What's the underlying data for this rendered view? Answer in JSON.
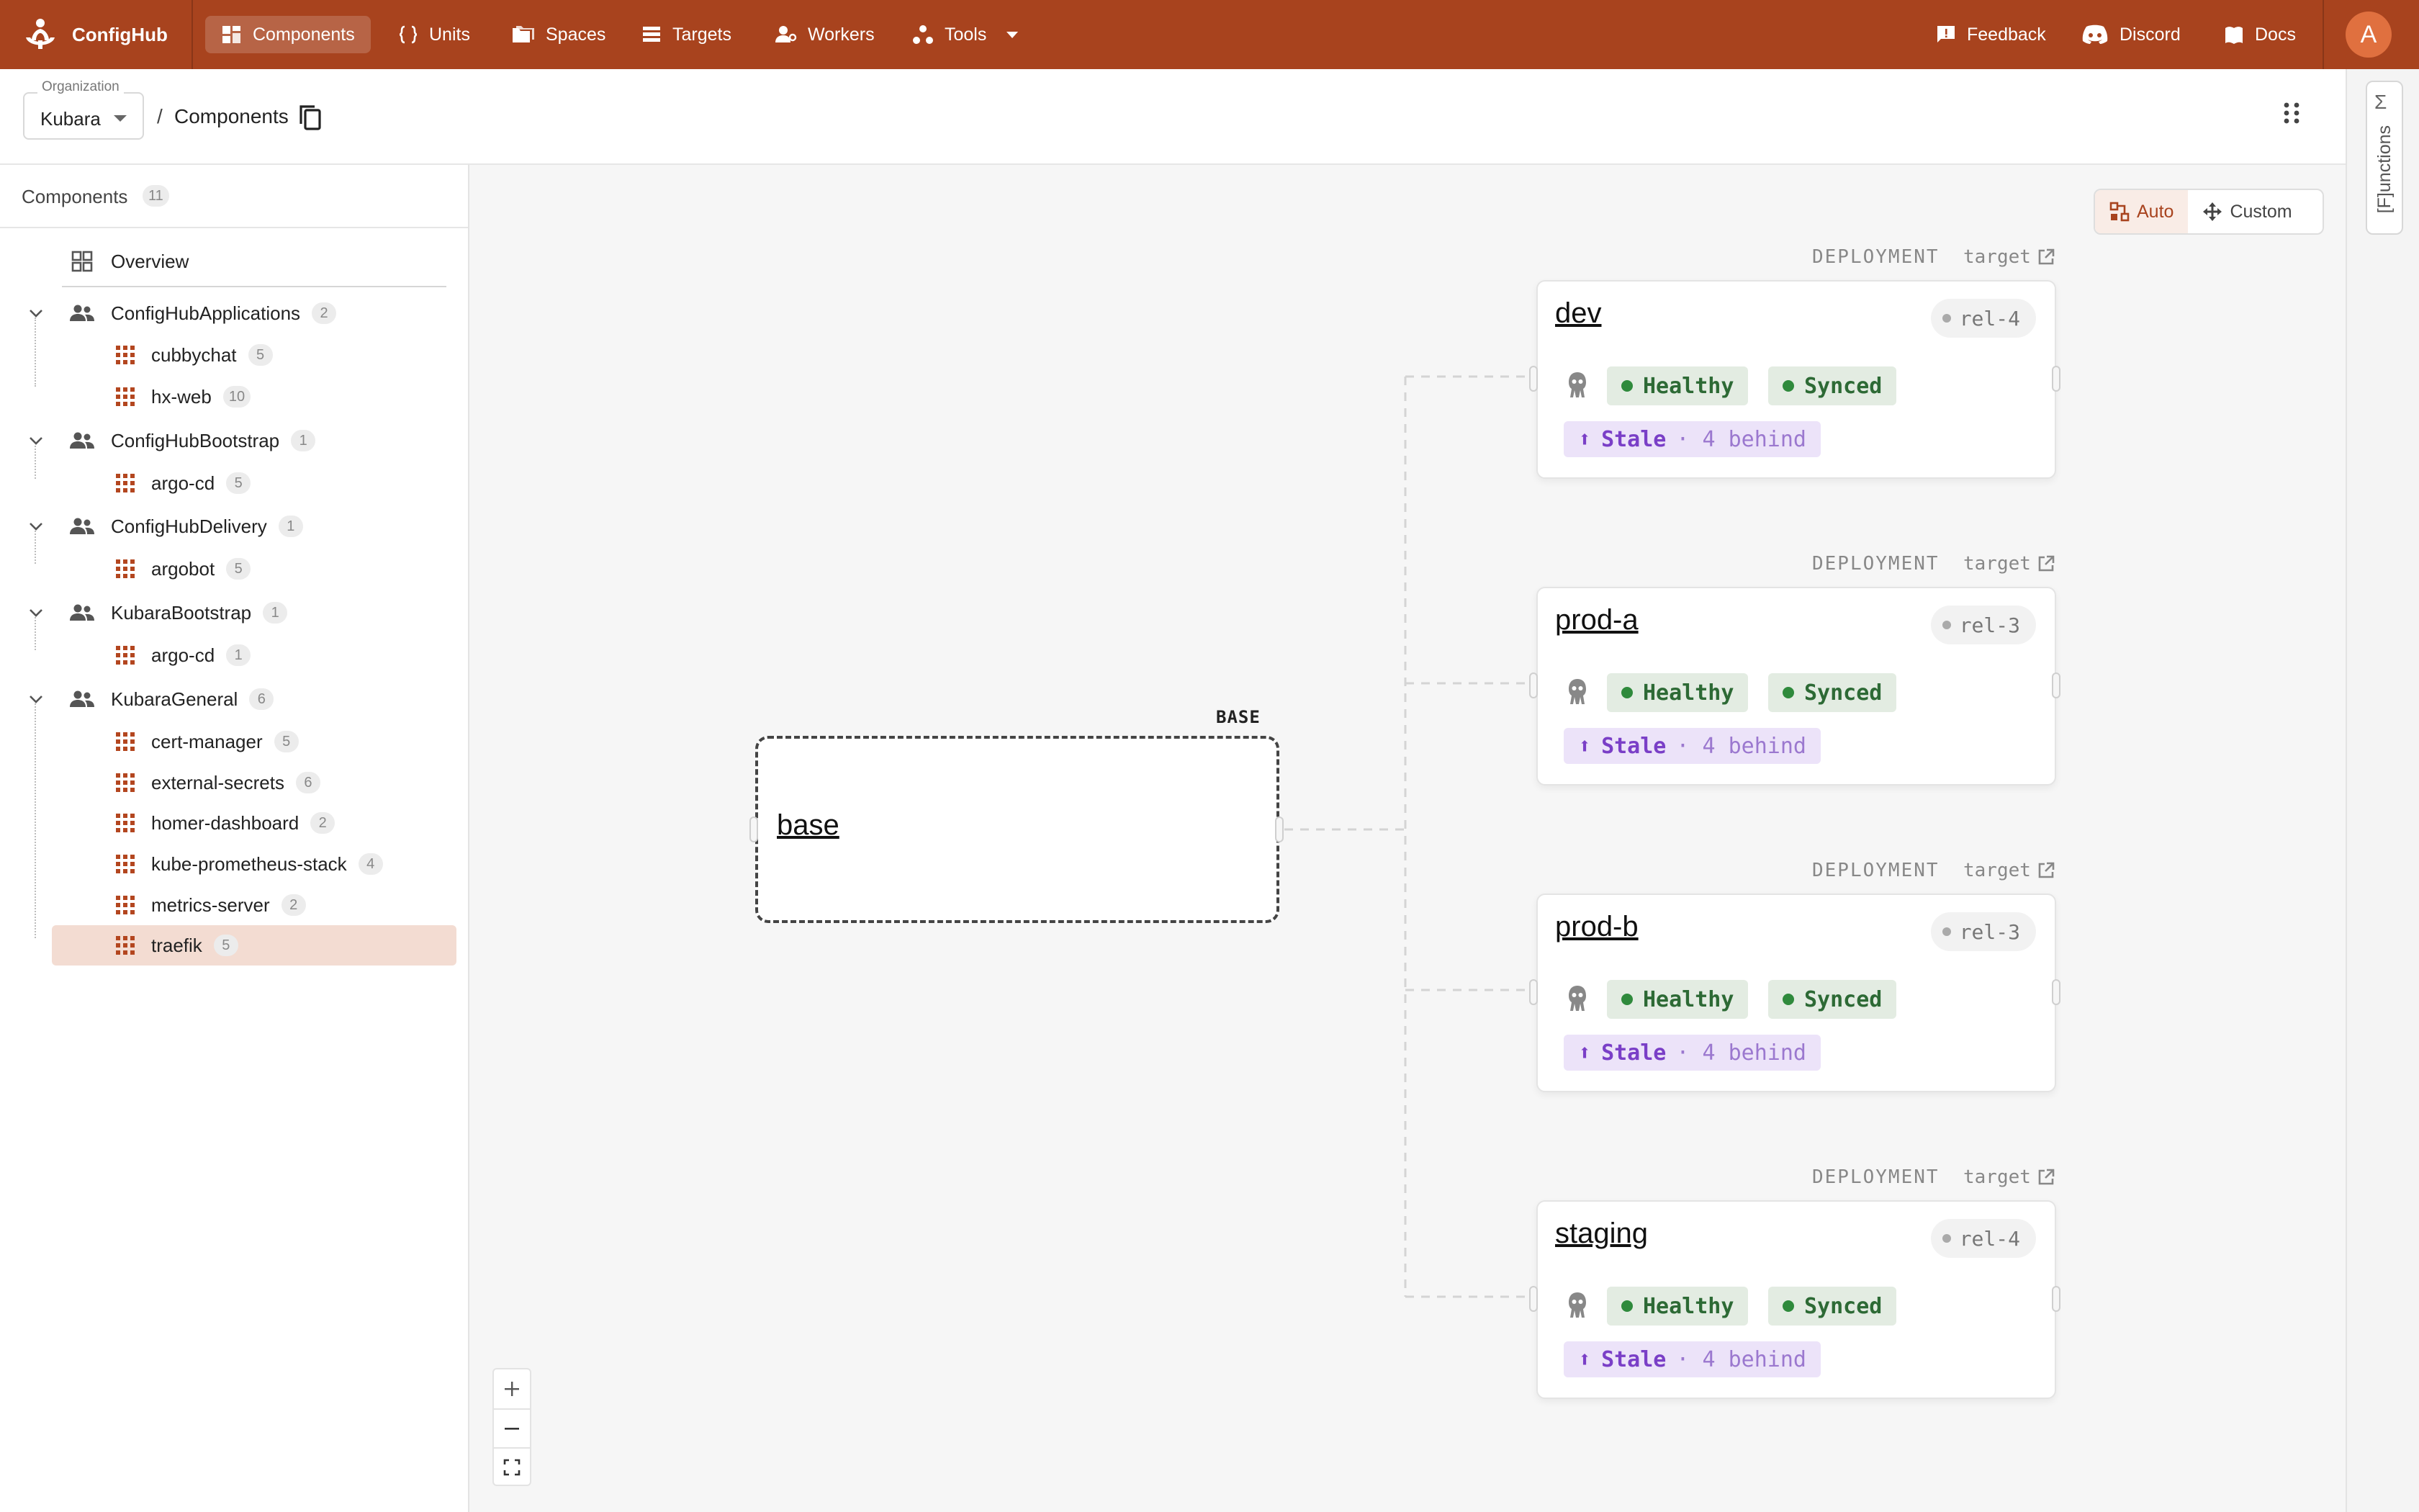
{
  "app": {
    "name": "ConfigHub"
  },
  "nav": {
    "items": [
      {
        "label": "Components",
        "icon": "components-icon",
        "active": true
      },
      {
        "label": "Units",
        "icon": "braces-icon"
      },
      {
        "label": "Spaces",
        "icon": "folders-icon"
      },
      {
        "label": "Targets",
        "icon": "list-icon"
      },
      {
        "label": "Workers",
        "icon": "workers-icon"
      },
      {
        "label": "Tools",
        "icon": "tools-icon"
      }
    ],
    "right": [
      {
        "label": "Feedback",
        "icon": "feedback-icon"
      },
      {
        "label": "Discord",
        "icon": "discord-icon"
      },
      {
        "label": "Docs",
        "icon": "docs-icon"
      }
    ],
    "avatar_initial": "A"
  },
  "breadcrumb": {
    "org_label": "Organization",
    "org_value": "Kubara",
    "separator": "/",
    "current": "Components"
  },
  "functions_panel": {
    "symbol": "Σ",
    "label": "[F]unctions"
  },
  "sidebar": {
    "title": "Components",
    "count": "11",
    "overview_label": "Overview",
    "groups": [
      {
        "name": "ConfigHubApplications",
        "count": "2",
        "children": [
          {
            "name": "cubbychat",
            "count": "5"
          },
          {
            "name": "hx-web",
            "count": "10"
          }
        ]
      },
      {
        "name": "ConfigHubBootstrap",
        "count": "1",
        "children": [
          {
            "name": "argo-cd",
            "count": "5"
          }
        ]
      },
      {
        "name": "ConfigHubDelivery",
        "count": "1",
        "children": [
          {
            "name": "argobot",
            "count": "5"
          }
        ]
      },
      {
        "name": "KubaraBootstrap",
        "count": "1",
        "children": [
          {
            "name": "argo-cd",
            "count": "1"
          }
        ]
      },
      {
        "name": "KubaraGeneral",
        "count": "6",
        "children": [
          {
            "name": "cert-manager",
            "count": "5"
          },
          {
            "name": "external-secrets",
            "count": "6"
          },
          {
            "name": "homer-dashboard",
            "count": "2"
          },
          {
            "name": "kube-prometheus-stack",
            "count": "4"
          },
          {
            "name": "metrics-server",
            "count": "2"
          },
          {
            "name": "traefik",
            "count": "5",
            "selected": true
          }
        ]
      }
    ]
  },
  "canvas": {
    "layout_toggle": {
      "auto_label": "Auto",
      "custom_label": "Custom",
      "active": "Auto"
    },
    "base": {
      "tag": "BASE",
      "name": "base"
    },
    "deployments": [
      {
        "kind": "DEPLOYMENT",
        "target_label": "target",
        "name": "dev",
        "release": "rel-4",
        "health": "Healthy",
        "sync": "Synced",
        "stale": "Stale",
        "behind": "· 4 behind"
      },
      {
        "kind": "DEPLOYMENT",
        "target_label": "target",
        "name": "prod-a",
        "release": "rel-3",
        "health": "Healthy",
        "sync": "Synced",
        "stale": "Stale",
        "behind": "· 4 behind"
      },
      {
        "kind": "DEPLOYMENT",
        "target_label": "target",
        "name": "prod-b",
        "release": "rel-3",
        "health": "Healthy",
        "sync": "Synced",
        "stale": "Stale",
        "behind": "· 4 behind"
      },
      {
        "kind": "DEPLOYMENT",
        "target_label": "target",
        "name": "staging",
        "release": "rel-4",
        "health": "Healthy",
        "sync": "Synced",
        "stale": "Stale",
        "behind": "· 4 behind"
      }
    ],
    "zoom_controls": [
      "+",
      "−",
      "fit"
    ]
  },
  "colors": {
    "brand": "#a8431e",
    "healthy": "#2f8a3c",
    "stale": "#7a3fc7",
    "selected_row": "#f3dcd2"
  }
}
